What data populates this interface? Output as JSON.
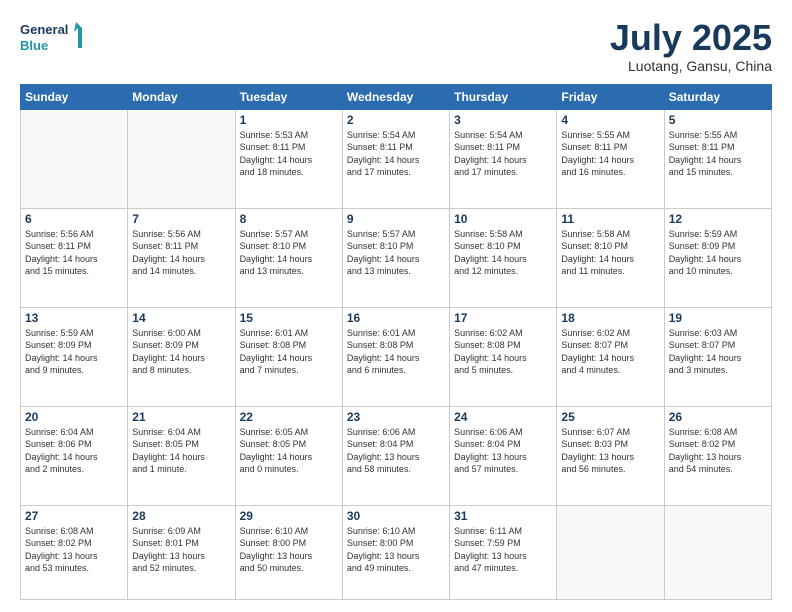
{
  "header": {
    "logo_line1": "General",
    "logo_line2": "Blue",
    "month": "July 2025",
    "location": "Luotang, Gansu, China"
  },
  "days_of_week": [
    "Sunday",
    "Monday",
    "Tuesday",
    "Wednesday",
    "Thursday",
    "Friday",
    "Saturday"
  ],
  "weeks": [
    [
      {
        "day": "",
        "info": ""
      },
      {
        "day": "",
        "info": ""
      },
      {
        "day": "1",
        "info": "Sunrise: 5:53 AM\nSunset: 8:11 PM\nDaylight: 14 hours\nand 18 minutes."
      },
      {
        "day": "2",
        "info": "Sunrise: 5:54 AM\nSunset: 8:11 PM\nDaylight: 14 hours\nand 17 minutes."
      },
      {
        "day": "3",
        "info": "Sunrise: 5:54 AM\nSunset: 8:11 PM\nDaylight: 14 hours\nand 17 minutes."
      },
      {
        "day": "4",
        "info": "Sunrise: 5:55 AM\nSunset: 8:11 PM\nDaylight: 14 hours\nand 16 minutes."
      },
      {
        "day": "5",
        "info": "Sunrise: 5:55 AM\nSunset: 8:11 PM\nDaylight: 14 hours\nand 15 minutes."
      }
    ],
    [
      {
        "day": "6",
        "info": "Sunrise: 5:56 AM\nSunset: 8:11 PM\nDaylight: 14 hours\nand 15 minutes."
      },
      {
        "day": "7",
        "info": "Sunrise: 5:56 AM\nSunset: 8:11 PM\nDaylight: 14 hours\nand 14 minutes."
      },
      {
        "day": "8",
        "info": "Sunrise: 5:57 AM\nSunset: 8:10 PM\nDaylight: 14 hours\nand 13 minutes."
      },
      {
        "day": "9",
        "info": "Sunrise: 5:57 AM\nSunset: 8:10 PM\nDaylight: 14 hours\nand 13 minutes."
      },
      {
        "day": "10",
        "info": "Sunrise: 5:58 AM\nSunset: 8:10 PM\nDaylight: 14 hours\nand 12 minutes."
      },
      {
        "day": "11",
        "info": "Sunrise: 5:58 AM\nSunset: 8:10 PM\nDaylight: 14 hours\nand 11 minutes."
      },
      {
        "day": "12",
        "info": "Sunrise: 5:59 AM\nSunset: 8:09 PM\nDaylight: 14 hours\nand 10 minutes."
      }
    ],
    [
      {
        "day": "13",
        "info": "Sunrise: 5:59 AM\nSunset: 8:09 PM\nDaylight: 14 hours\nand 9 minutes."
      },
      {
        "day": "14",
        "info": "Sunrise: 6:00 AM\nSunset: 8:09 PM\nDaylight: 14 hours\nand 8 minutes."
      },
      {
        "day": "15",
        "info": "Sunrise: 6:01 AM\nSunset: 8:08 PM\nDaylight: 14 hours\nand 7 minutes."
      },
      {
        "day": "16",
        "info": "Sunrise: 6:01 AM\nSunset: 8:08 PM\nDaylight: 14 hours\nand 6 minutes."
      },
      {
        "day": "17",
        "info": "Sunrise: 6:02 AM\nSunset: 8:08 PM\nDaylight: 14 hours\nand 5 minutes."
      },
      {
        "day": "18",
        "info": "Sunrise: 6:02 AM\nSunset: 8:07 PM\nDaylight: 14 hours\nand 4 minutes."
      },
      {
        "day": "19",
        "info": "Sunrise: 6:03 AM\nSunset: 8:07 PM\nDaylight: 14 hours\nand 3 minutes."
      }
    ],
    [
      {
        "day": "20",
        "info": "Sunrise: 6:04 AM\nSunset: 8:06 PM\nDaylight: 14 hours\nand 2 minutes."
      },
      {
        "day": "21",
        "info": "Sunrise: 6:04 AM\nSunset: 8:05 PM\nDaylight: 14 hours\nand 1 minute."
      },
      {
        "day": "22",
        "info": "Sunrise: 6:05 AM\nSunset: 8:05 PM\nDaylight: 14 hours\nand 0 minutes."
      },
      {
        "day": "23",
        "info": "Sunrise: 6:06 AM\nSunset: 8:04 PM\nDaylight: 13 hours\nand 58 minutes."
      },
      {
        "day": "24",
        "info": "Sunrise: 6:06 AM\nSunset: 8:04 PM\nDaylight: 13 hours\nand 57 minutes."
      },
      {
        "day": "25",
        "info": "Sunrise: 6:07 AM\nSunset: 8:03 PM\nDaylight: 13 hours\nand 56 minutes."
      },
      {
        "day": "26",
        "info": "Sunrise: 6:08 AM\nSunset: 8:02 PM\nDaylight: 13 hours\nand 54 minutes."
      }
    ],
    [
      {
        "day": "27",
        "info": "Sunrise: 6:08 AM\nSunset: 8:02 PM\nDaylight: 13 hours\nand 53 minutes."
      },
      {
        "day": "28",
        "info": "Sunrise: 6:09 AM\nSunset: 8:01 PM\nDaylight: 13 hours\nand 52 minutes."
      },
      {
        "day": "29",
        "info": "Sunrise: 6:10 AM\nSunset: 8:00 PM\nDaylight: 13 hours\nand 50 minutes."
      },
      {
        "day": "30",
        "info": "Sunrise: 6:10 AM\nSunset: 8:00 PM\nDaylight: 13 hours\nand 49 minutes."
      },
      {
        "day": "31",
        "info": "Sunrise: 6:11 AM\nSunset: 7:59 PM\nDaylight: 13 hours\nand 47 minutes."
      },
      {
        "day": "",
        "info": ""
      },
      {
        "day": "",
        "info": ""
      }
    ]
  ]
}
